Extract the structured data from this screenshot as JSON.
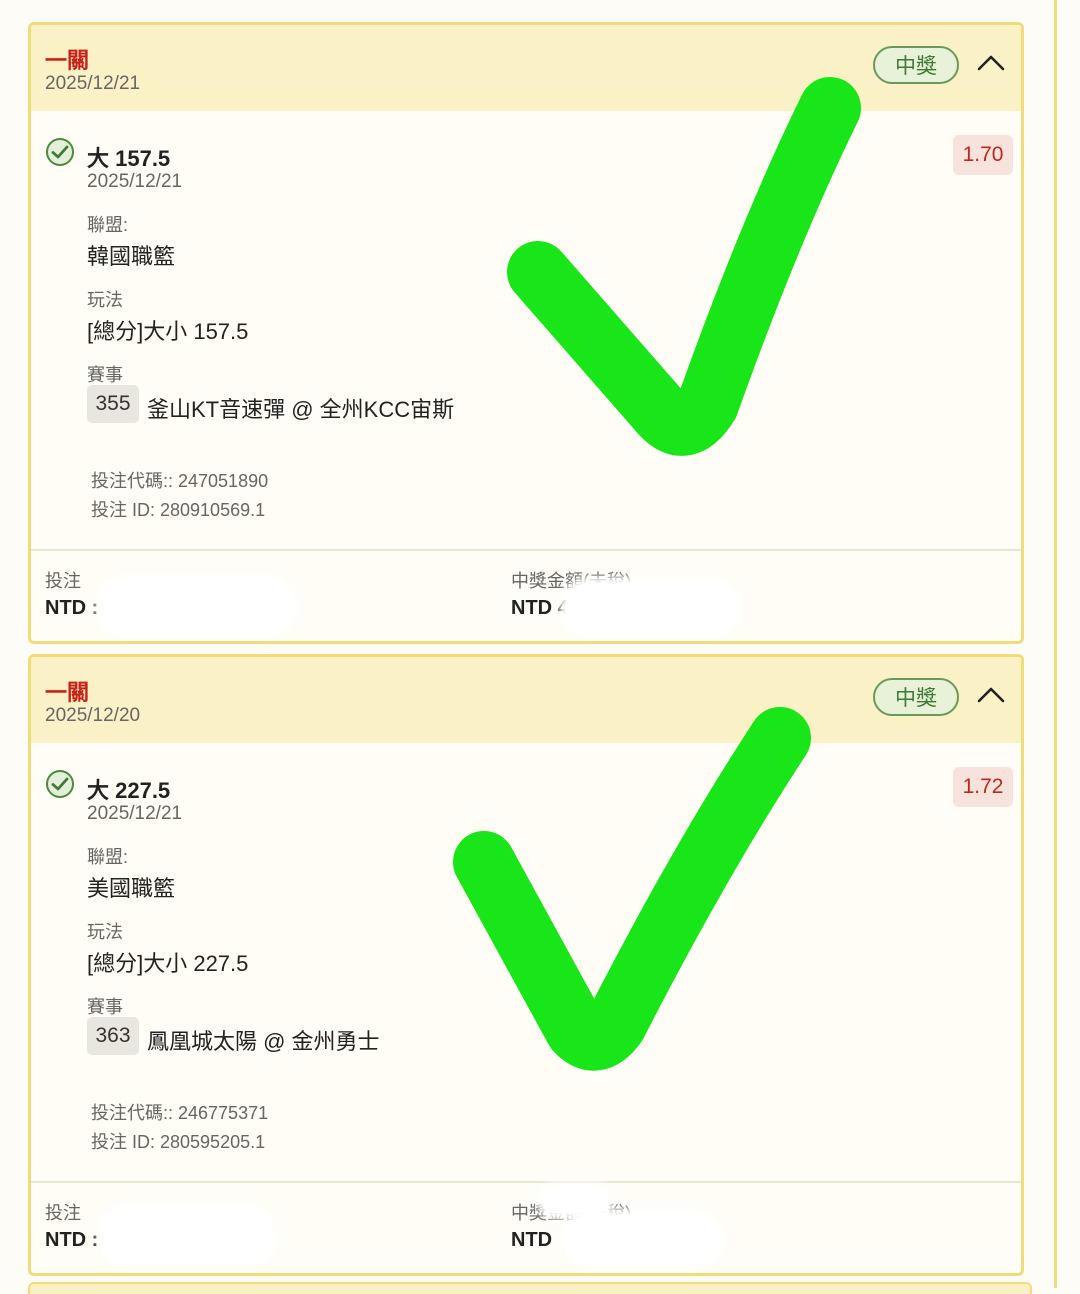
{
  "bets": [
    {
      "type": "一關",
      "date": "2025/12/21",
      "status": "中獎",
      "selection": "大 157.5",
      "selection_date": "2025/12/21",
      "odds": "1.70",
      "league_label": "聯盟:",
      "league": "韓國職籃",
      "market_label": "玩法",
      "market": "[總分]大小 157.5",
      "event_label": "賽事",
      "match_no": "355",
      "match_name": "釜山KT音速彈 @ 全州KCC宙斯",
      "bet_code": "投注代碼:: 247051890",
      "bet_id": "投注 ID: 280910569.1",
      "stake_label": "投注",
      "stake_value": "NTD :",
      "payout_label": "中獎金額(未稅)",
      "payout_value": "NTD 4"
    },
    {
      "type": "一關",
      "date": "2025/12/20",
      "status": "中獎",
      "selection": "大 227.5",
      "selection_date": "2025/12/21",
      "odds": "1.72",
      "league_label": "聯盟:",
      "league": "美國職籃",
      "market_label": "玩法",
      "market": "[總分]大小 227.5",
      "event_label": "賽事",
      "match_no": "363",
      "match_name": "鳳凰城太陽 @ 金州勇士",
      "bet_code": "投注代碼:: 246775371",
      "bet_id": "投注 ID: 280595205.1",
      "stake_label": "投注",
      "stake_value": "NTD :",
      "payout_label": "中獎金額(未稅)",
      "payout_value": "NTD"
    }
  ],
  "colors": {
    "accent_red": "#c8221a",
    "card_border": "#f2dc7a",
    "header_bg": "#fbf1c6",
    "win_green": "#3d7a33",
    "overlay_check": "#19e619"
  },
  "icons": [
    "check-circle-icon",
    "chevron-up-icon"
  ]
}
